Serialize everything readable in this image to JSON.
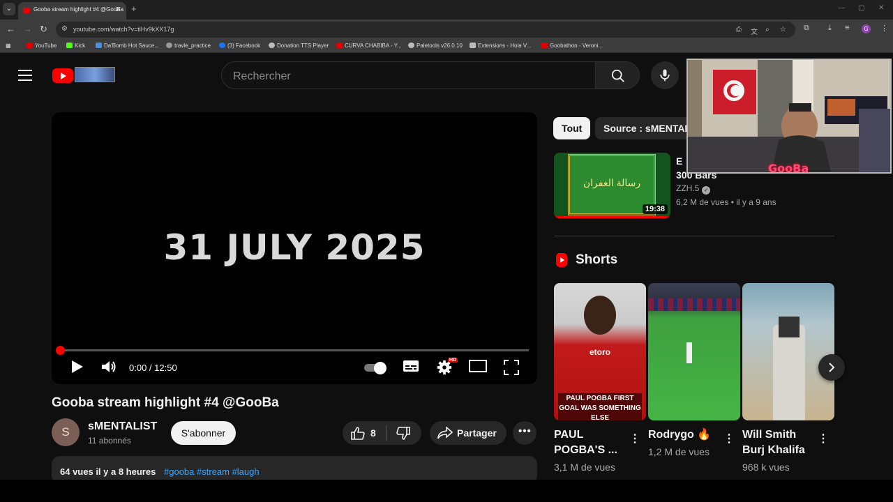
{
  "browser": {
    "tab_title": "Gooba stream highlight #4 @GooBa",
    "url": "youtube.com/watch?v=tiHv9kXX17g",
    "bookmarks": [
      {
        "label": "YouTube",
        "color": "#e00000"
      },
      {
        "label": "Kick",
        "color": "#53fc18"
      },
      {
        "label": "Da'Bomb Hot Sauce...",
        "color": "#4a90e2"
      },
      {
        "label": "travle_practice",
        "color": "#999999"
      },
      {
        "label": "(3) Facebook",
        "color": "#1877f2"
      },
      {
        "label": "Donation TTS Player",
        "color": "#bbbbbb"
      },
      {
        "label": "CURVA CHABIBA - Y...",
        "color": "#e00000"
      },
      {
        "label": "Paletools v26.0.10",
        "color": "#bbbbbb"
      },
      {
        "label": "Extensions - Hola V...",
        "color": "#bbbbbb"
      },
      {
        "label": "Goobathon - Veroni...",
        "color": "#e00000"
      }
    ]
  },
  "header": {
    "search_placeholder": "Rechercher"
  },
  "player": {
    "overlay_text": "31 JULY 2025",
    "time": "0:00 / 12:50",
    "progress": 0.0,
    "hd_badge": "HD"
  },
  "video": {
    "title": "Gooba stream highlight #4 @GooBa",
    "channel_initial": "S",
    "channel_name": "sMENTALIST",
    "subscribers": "11 abonnés",
    "subscribe_label": "S'abonner",
    "likes": "8",
    "share_label": "Partager",
    "stats": "64 vues  il y a 8 heures",
    "tags": "#gooba #stream #laugh"
  },
  "sidebar": {
    "chips": [
      {
        "label": "Tout",
        "active": true
      },
      {
        "label": "Source : sMENTAL",
        "active": false
      }
    ],
    "recommended": {
      "title_line1": "E",
      "title_line2": "300 Bars",
      "arabic_text": "رسالة الغفران",
      "channel": "ZZH.5",
      "meta": "6,2 M de vues • il y a 9 ans",
      "duration": "19:38"
    },
    "shorts_title": "Shorts",
    "shorts": [
      {
        "title": "PAUL POGBA'S ...",
        "views": "3,1 M de vues",
        "caption": "PAUL POGBA FIRST GOAL WAS SOMETHING ELSE"
      },
      {
        "title": "Rodrygo 🔥",
        "views": "1,2 M de vues",
        "caption": ""
      },
      {
        "title": "Will Smith Burj Khalifa",
        "views": "968 k vues",
        "caption": ""
      }
    ]
  },
  "webcam": {
    "overlay_name": "GooBa"
  },
  "colors": {
    "accent": "#ff0000",
    "link": "#3ea6ff",
    "background": "#0f0f0f"
  }
}
